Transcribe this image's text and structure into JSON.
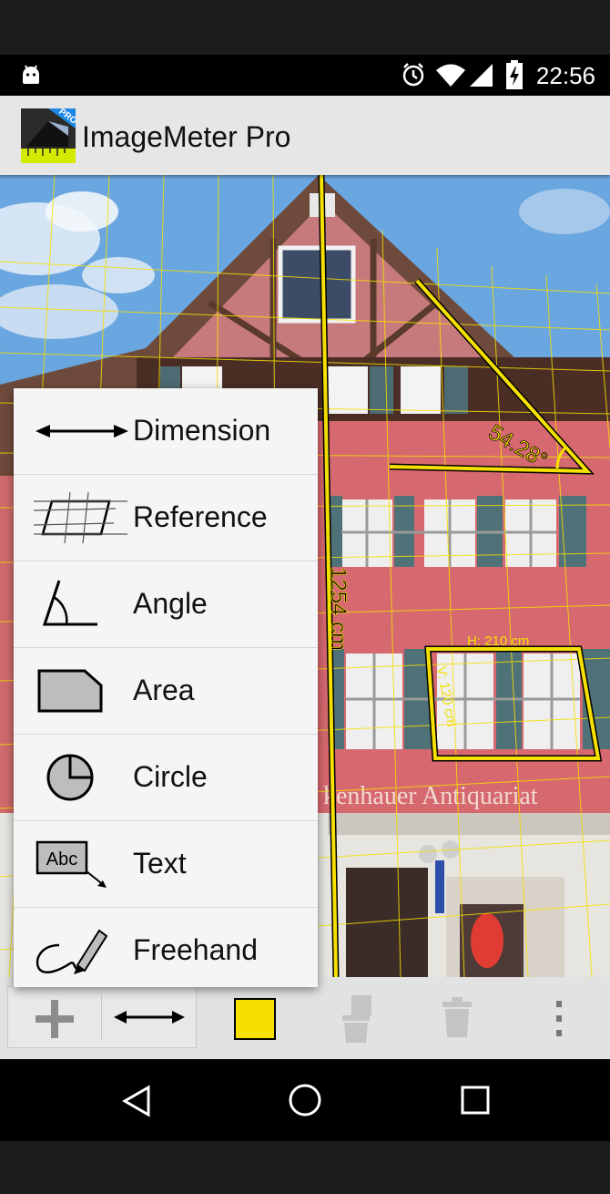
{
  "status_bar": {
    "time": "22:56",
    "icons": [
      "android-icon",
      "alarm-icon",
      "wifi-icon",
      "signal-icon",
      "battery-charging-icon"
    ]
  },
  "app_bar": {
    "title": "ImageMeter Pro",
    "logo_badge": "PRO"
  },
  "photo_annotations": {
    "vertical_dimension": "1254 cm",
    "angle": "54.28°",
    "rect_width": "H: 210 cm",
    "rect_height": "V: 120 cm",
    "shop_sign": "kenhauer Antiquariat"
  },
  "add_menu": {
    "items": [
      {
        "label": "Dimension",
        "icon": "dimension-arrow-icon"
      },
      {
        "label": "Reference",
        "icon": "reference-grid-icon"
      },
      {
        "label": "Angle",
        "icon": "angle-icon"
      },
      {
        "label": "Area",
        "icon": "area-polygon-icon"
      },
      {
        "label": "Circle",
        "icon": "circle-icon"
      },
      {
        "label": "Text",
        "icon": "text-box-icon",
        "icon_text": "Abc"
      },
      {
        "label": "Freehand",
        "icon": "pencil-icon"
      }
    ]
  },
  "toolbar": {
    "buttons": [
      "add-icon",
      "dimension-arrow-icon",
      "color-swatch",
      "brush-icon",
      "trash-icon",
      "more-vert-icon"
    ],
    "selected_color": "#f5e000"
  },
  "nav_bar": {
    "buttons": [
      "back-icon",
      "home-icon",
      "recents-icon"
    ]
  },
  "colors": {
    "measure_yellow": "#f5e000",
    "app_bar": "#e6e6e6",
    "menu_bg": "#f5f5f5"
  }
}
